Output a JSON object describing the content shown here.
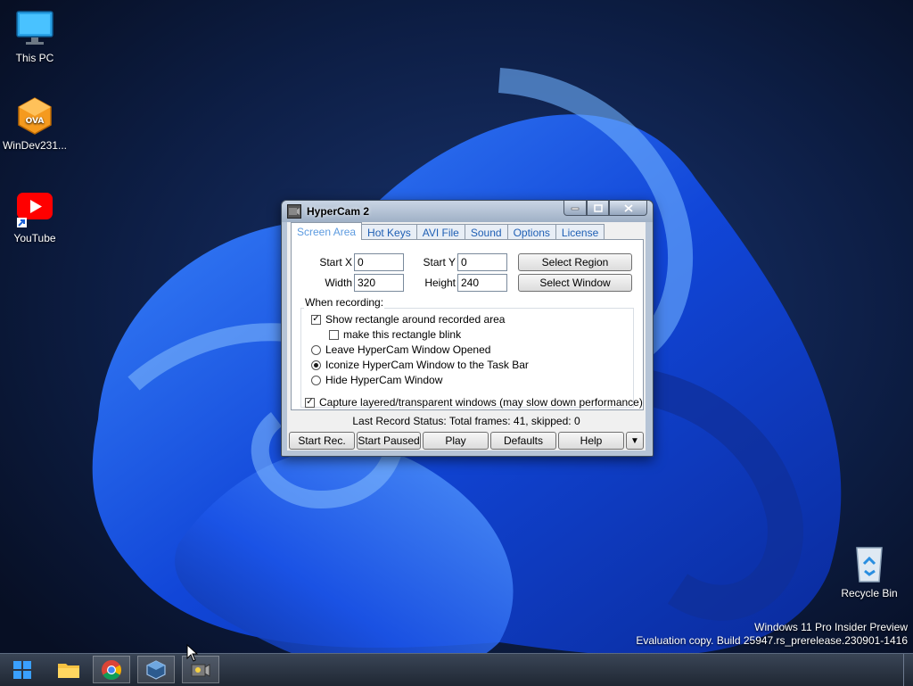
{
  "desktop": {
    "icons": [
      {
        "label": "This PC",
        "icon": "monitor-icon"
      },
      {
        "label": "WinDev231...",
        "icon": "virtualbox-ova-icon"
      },
      {
        "label": "YouTube",
        "icon": "youtube-icon"
      },
      {
        "label": "Recycle Bin",
        "icon": "recycle-bin-icon"
      }
    ],
    "watermark_line1": "Windows 11 Pro Insider Preview",
    "watermark_line2": "Evaluation copy. Build 25947.rs_prerelease.230901-1416"
  },
  "window": {
    "title": "HyperCam 2",
    "tabs": [
      "Screen Area",
      "Hot Keys",
      "AVI File",
      "Sound",
      "Options",
      "License"
    ],
    "active_tab": "Screen Area",
    "fields": {
      "start_x_label": "Start X",
      "start_x_value": "0",
      "start_y_label": "Start Y",
      "start_y_value": "0",
      "width_label": "Width",
      "width_value": "320",
      "height_label": "Height",
      "height_value": "240"
    },
    "buttons": {
      "select_region": "Select Region",
      "select_window": "Select Window"
    },
    "when_recording": {
      "label": "When recording:",
      "show_rectangle": {
        "label": "Show rectangle around recorded area",
        "checked": true
      },
      "rectangle_blink": {
        "label": "make this rectangle blink",
        "checked": false
      },
      "radio_options": [
        {
          "label": "Leave HyperCam Window Opened",
          "selected": false
        },
        {
          "label": "Iconize HyperCam Window to the Task Bar",
          "selected": true
        },
        {
          "label": "Hide HyperCam Window",
          "selected": false
        }
      ]
    },
    "capture_layered": {
      "label": "Capture layered/transparent windows (may slow down performance)",
      "checked": true
    },
    "status": "Last Record Status: Total frames: 41, skipped: 0",
    "bottom_buttons": {
      "start_rec": "Start Rec.",
      "start_paused": "Start Paused",
      "play": "Play",
      "defaults": "Defaults",
      "help": "Help",
      "more": "▼"
    }
  },
  "taskbar": {
    "items": [
      "start-icon",
      "file-explorer-icon",
      "chrome-icon",
      "virtualbox-icon",
      "hypercam-icon"
    ]
  }
}
